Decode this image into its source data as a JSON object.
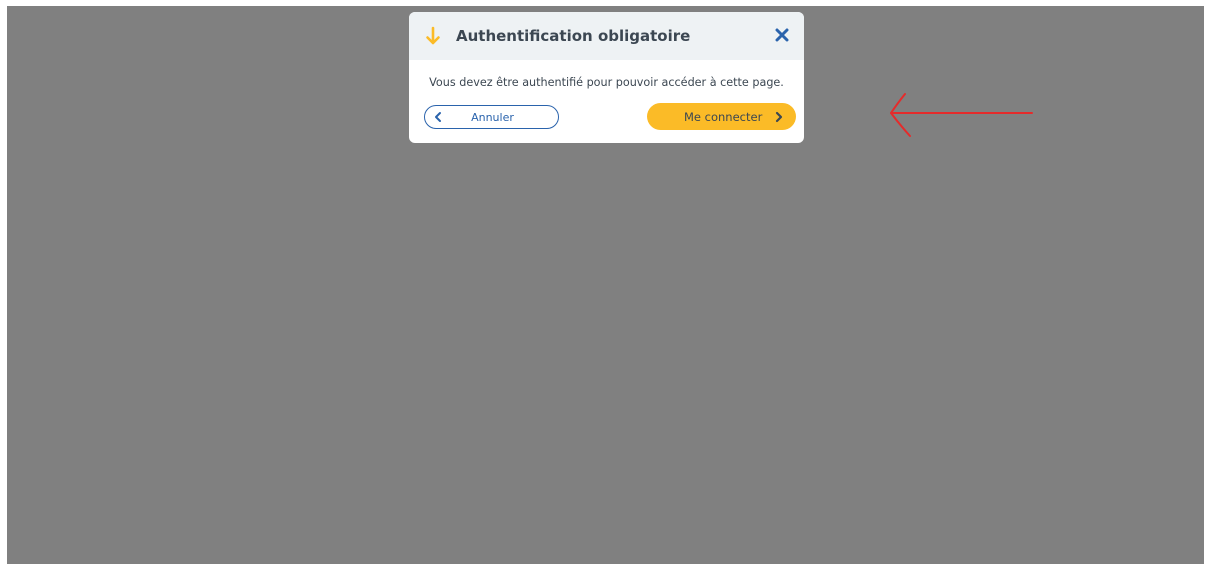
{
  "modal": {
    "title": "Authentification obligatoire",
    "message": "Vous devez être authentifié pour pouvoir accéder à cette page.",
    "header_icon": "arrow-down-icon",
    "close_icon": "close-icon"
  },
  "actions": {
    "cancel_label": "Annuler",
    "connect_label": "Me connecter"
  },
  "colors": {
    "overlay": "#808080",
    "accent_yellow": "#fbbb27",
    "primary_blue": "#2a63ac",
    "header_bg": "#eef2f4",
    "text_dark": "#3c4752",
    "annotation_red": "#e52b2b"
  }
}
